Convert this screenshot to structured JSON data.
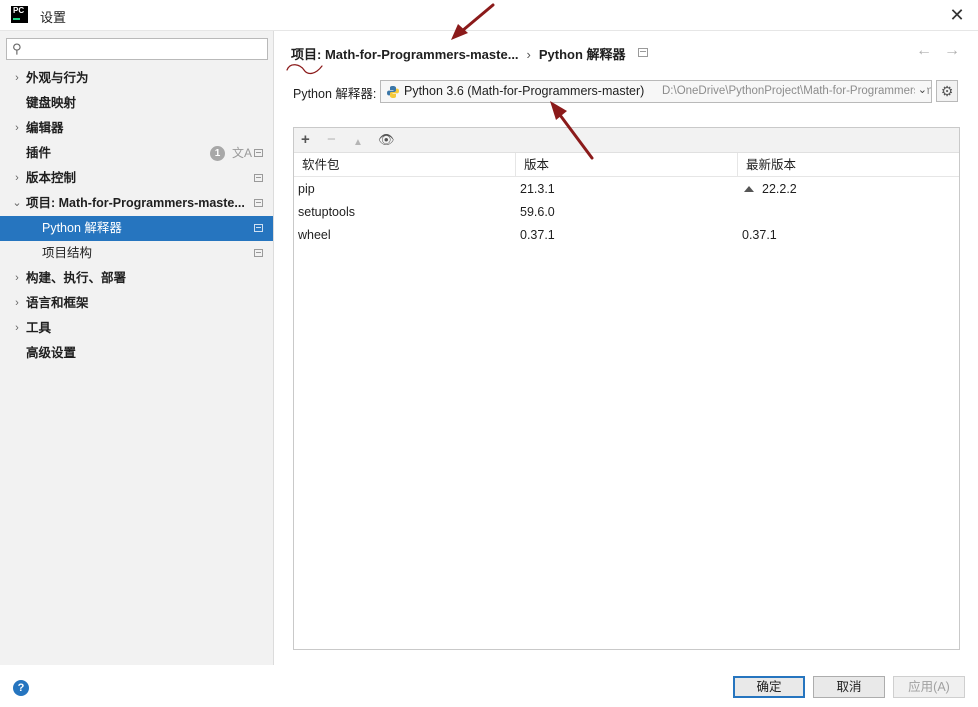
{
  "window": {
    "title": "设置",
    "app_logo_text": "PC"
  },
  "sidebar": {
    "search_placeholder": "",
    "items": [
      {
        "label": "外观与行为",
        "expandable": true
      },
      {
        "label": "键盘映射",
        "expandable": false
      },
      {
        "label": "编辑器",
        "expandable": true
      },
      {
        "label": "插件",
        "expandable": false,
        "badge": "1"
      },
      {
        "label": "版本控制",
        "expandable": true
      },
      {
        "label": "项目: Math-for-Programmers-maste...",
        "expandable": true,
        "expanded": true
      },
      {
        "label": "Python 解释器",
        "sub": true,
        "selected": true
      },
      {
        "label": "项目结构",
        "sub": true
      },
      {
        "label": "构建、执行、部署",
        "expandable": true
      },
      {
        "label": "语言和框架",
        "expandable": true
      },
      {
        "label": "工具",
        "expandable": true
      },
      {
        "label": "高级设置",
        "expandable": false
      }
    ]
  },
  "breadcrumb": {
    "project": "项目: Math-for-Programmers-maste...",
    "page": "Python 解释器"
  },
  "interpreter": {
    "label": "Python 解释器:",
    "name": "Python 3.6 (Math-for-Programmers-master)",
    "path": "D:\\OneDrive\\PythonProject\\Math-for-Programmers-master\\venv\\Scripts\\python.exe"
  },
  "packages": {
    "columns": [
      "软件包",
      "版本",
      "最新版本"
    ],
    "rows": [
      {
        "name": "pip",
        "version": "21.3.1",
        "latest": "22.2.2",
        "upgrade": true
      },
      {
        "name": "setuptools",
        "version": "59.6.0",
        "latest": "",
        "upgrade": false
      },
      {
        "name": "wheel",
        "version": "0.37.1",
        "latest": "0.37.1",
        "upgrade": false
      }
    ]
  },
  "buttons": {
    "ok": "确定",
    "cancel": "取消",
    "apply": "应用(A)"
  },
  "colors": {
    "selection": "#2675bf",
    "annotation": "#8b1a1a"
  }
}
